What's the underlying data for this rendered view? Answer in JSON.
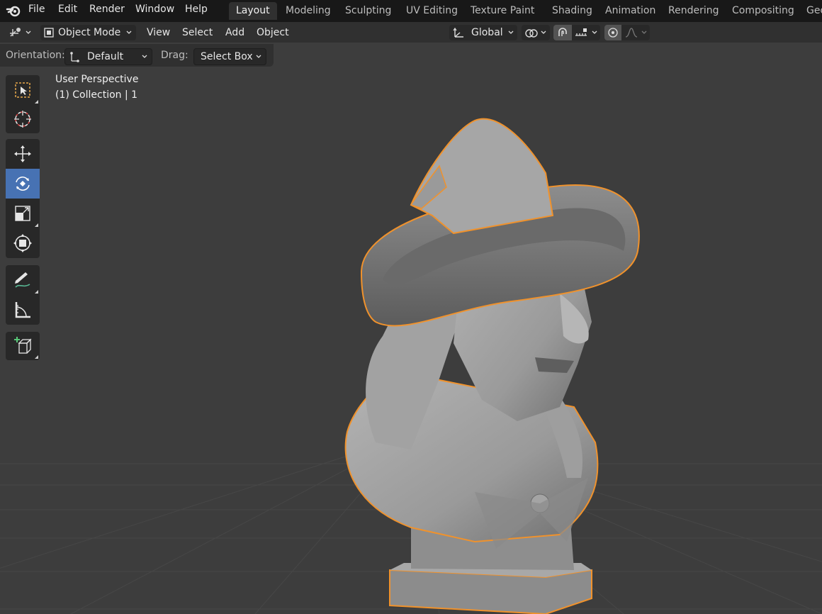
{
  "menu": {
    "items": [
      "File",
      "Edit",
      "Render",
      "Window",
      "Help"
    ]
  },
  "workspaces": {
    "tabs": [
      "Layout",
      "Modeling",
      "Sculpting",
      "UV Editing",
      "Texture Paint",
      "Shading",
      "Animation",
      "Rendering",
      "Compositing",
      "Geo"
    ],
    "active": "Layout"
  },
  "header": {
    "mode": "Object Mode",
    "view": "View",
    "select": "Select",
    "add": "Add",
    "object": "Object",
    "transform_orientation": "Global"
  },
  "tool_settings": {
    "orientation_label": "Orientation:",
    "orientation_value": "Default",
    "drag_label": "Drag:",
    "drag_value": "Select Box"
  },
  "viewport": {
    "perspective": "User Perspective",
    "collection": "(1) Collection | 1"
  },
  "tools": [
    {
      "name": "select-box-tool",
      "icon": "select-box-icon"
    },
    {
      "name": "cursor-tool",
      "icon": "cursor-icon"
    },
    {
      "name": "move-tool",
      "icon": "move-icon"
    },
    {
      "name": "rotate-tool",
      "icon": "rotate-icon",
      "active": true
    },
    {
      "name": "scale-tool",
      "icon": "scale-icon"
    },
    {
      "name": "transform-tool",
      "icon": "transform-icon"
    },
    {
      "name": "annotate-tool",
      "icon": "annotate-icon"
    },
    {
      "name": "measure-tool",
      "icon": "measure-icon"
    },
    {
      "name": "add-cube-tool",
      "icon": "add-cube-icon"
    }
  ],
  "colors": {
    "selection_outline": "#f0922c",
    "active_tool": "#4772b3",
    "model": "#9a9a9a"
  }
}
